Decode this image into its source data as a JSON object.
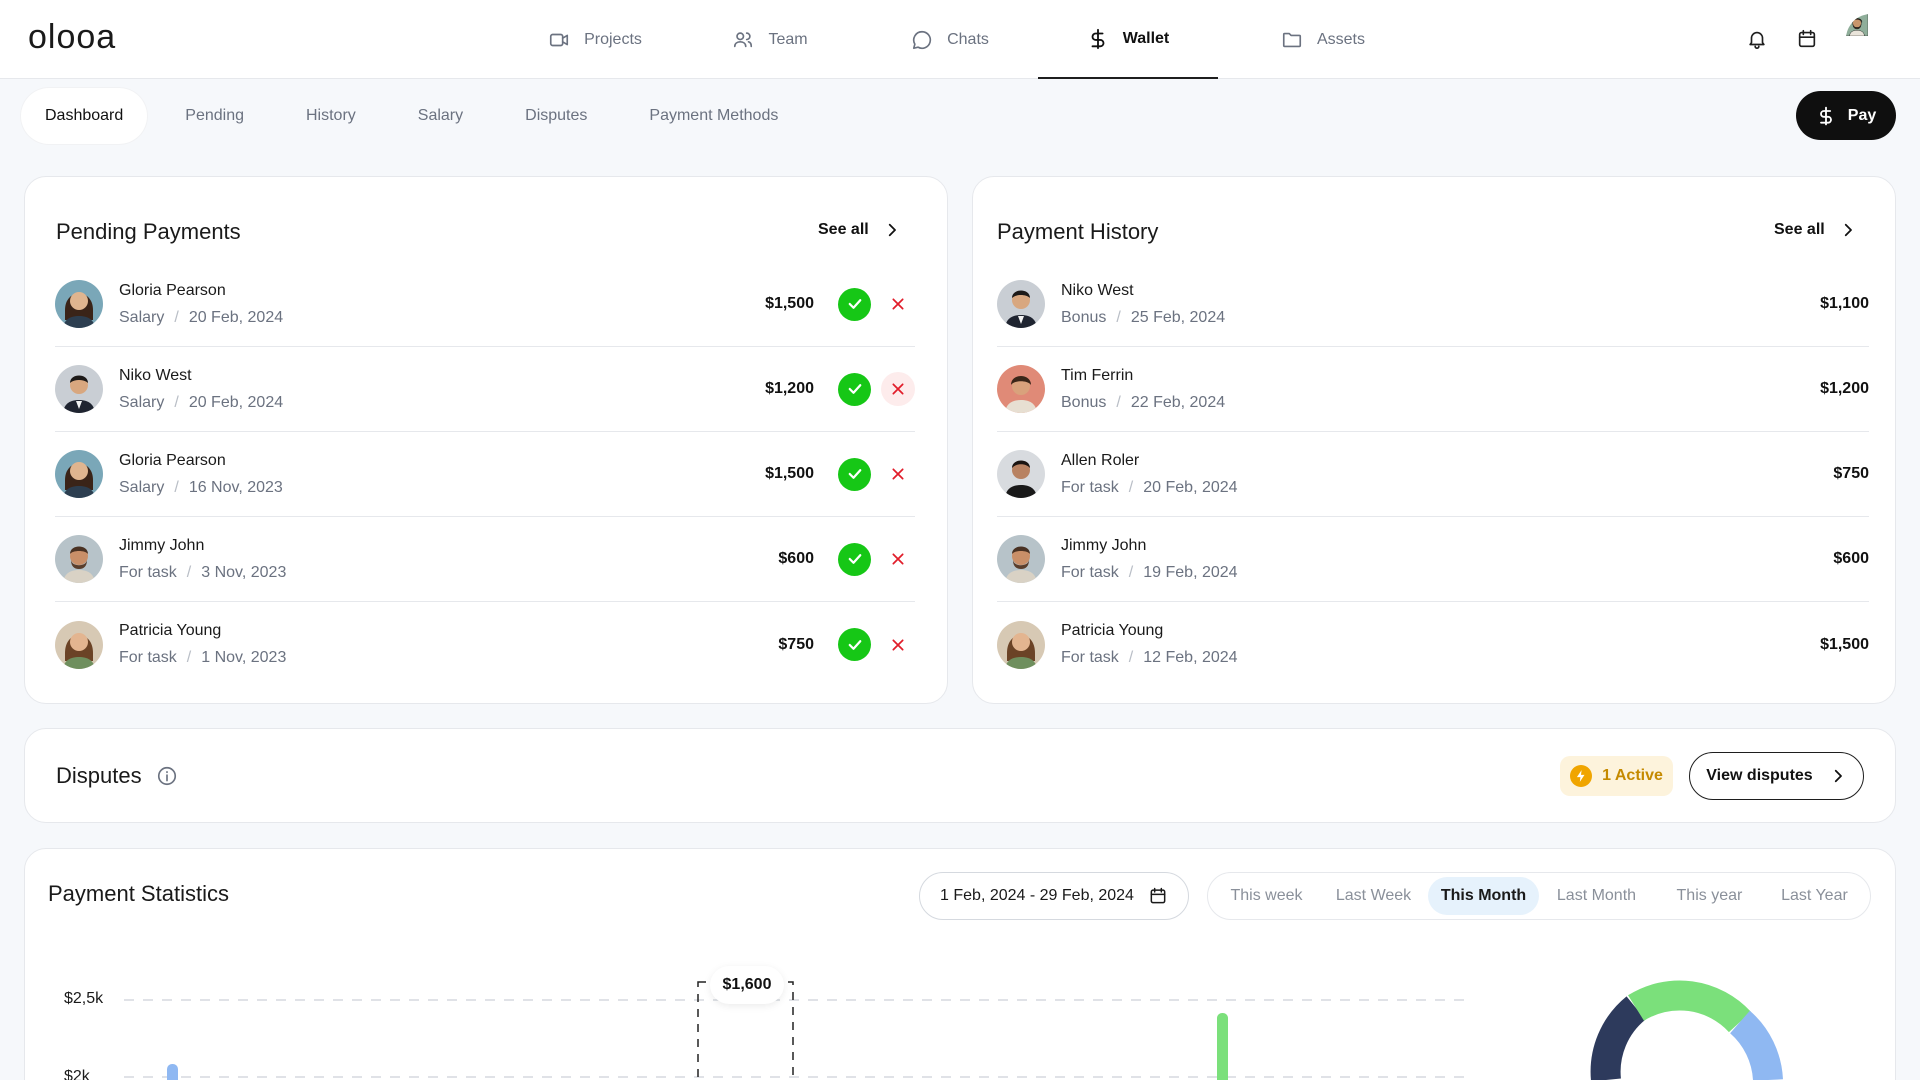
{
  "app": {
    "logo": "olooa"
  },
  "nav": [
    {
      "label": "Projects",
      "icon": "video-icon"
    },
    {
      "label": "Team",
      "icon": "users-icon"
    },
    {
      "label": "Chats",
      "icon": "chat-icon"
    },
    {
      "label": "Wallet",
      "icon": "dollar-icon",
      "active": true
    },
    {
      "label": "Assets",
      "icon": "folder-icon"
    }
  ],
  "subtabs": [
    {
      "label": "Dashboard",
      "active": true
    },
    {
      "label": "Pending"
    },
    {
      "label": "History"
    },
    {
      "label": "Salary"
    },
    {
      "label": "Disputes"
    },
    {
      "label": "Payment Methods"
    }
  ],
  "pay_button": {
    "label": "Pay"
  },
  "pending": {
    "title": "Pending Payments",
    "see_all": "See all",
    "items": [
      {
        "name": "Gloria Pearson",
        "type": "Salary",
        "date": "20 Feb, 2024",
        "amount": "$1,500"
      },
      {
        "name": "Niko West",
        "type": "Salary",
        "date": "20 Feb, 2024",
        "amount": "$1,200"
      },
      {
        "name": "Gloria Pearson",
        "type": "Salary",
        "date": "16 Nov, 2023",
        "amount": "$1,500"
      },
      {
        "name": "Jimmy John",
        "type": "For task",
        "date": "3 Nov, 2023",
        "amount": "$600"
      },
      {
        "name": "Patricia Young",
        "type": "For task",
        "date": "1 Nov, 2023",
        "amount": "$750"
      }
    ]
  },
  "history": {
    "title": "Payment History",
    "see_all": "See all",
    "items": [
      {
        "name": "Niko West",
        "type": "Bonus",
        "date": "25 Feb, 2024",
        "amount": "$1,100"
      },
      {
        "name": "Tim Ferrin",
        "type": "Bonus",
        "date": "22 Feb, 2024",
        "amount": "$1,200"
      },
      {
        "name": "Allen Roler",
        "type": "For task",
        "date": "20 Feb, 2024",
        "amount": "$750"
      },
      {
        "name": "Jimmy John",
        "type": "For task",
        "date": "19 Feb, 2024",
        "amount": "$600"
      },
      {
        "name": "Patricia Young",
        "type": "For task",
        "date": "12 Feb, 2024",
        "amount": "$1,500"
      }
    ]
  },
  "disputes": {
    "title": "Disputes",
    "active_badge": "1 Active",
    "view_button": "View disputes"
  },
  "stats": {
    "title": "Payment Statistics",
    "date_range": "1 Feb, 2024 - 29 Feb, 2024",
    "periods": [
      {
        "label": "This week"
      },
      {
        "label": "Last Week"
      },
      {
        "label": "This Month",
        "active": true
      },
      {
        "label": "Last Month"
      },
      {
        "label": "This year"
      },
      {
        "label": "Last Year"
      }
    ],
    "y_ticks": [
      "$2,5k",
      "$2k"
    ],
    "tooltip": "$1,600"
  },
  "colors": {
    "approve": "#16c716",
    "reject": "#e11d2a",
    "accent_green": "#7be07b",
    "accent_blue": "#8fb8f2",
    "dark_navy": "#2d3a5c",
    "badge_text": "#c58a00"
  }
}
